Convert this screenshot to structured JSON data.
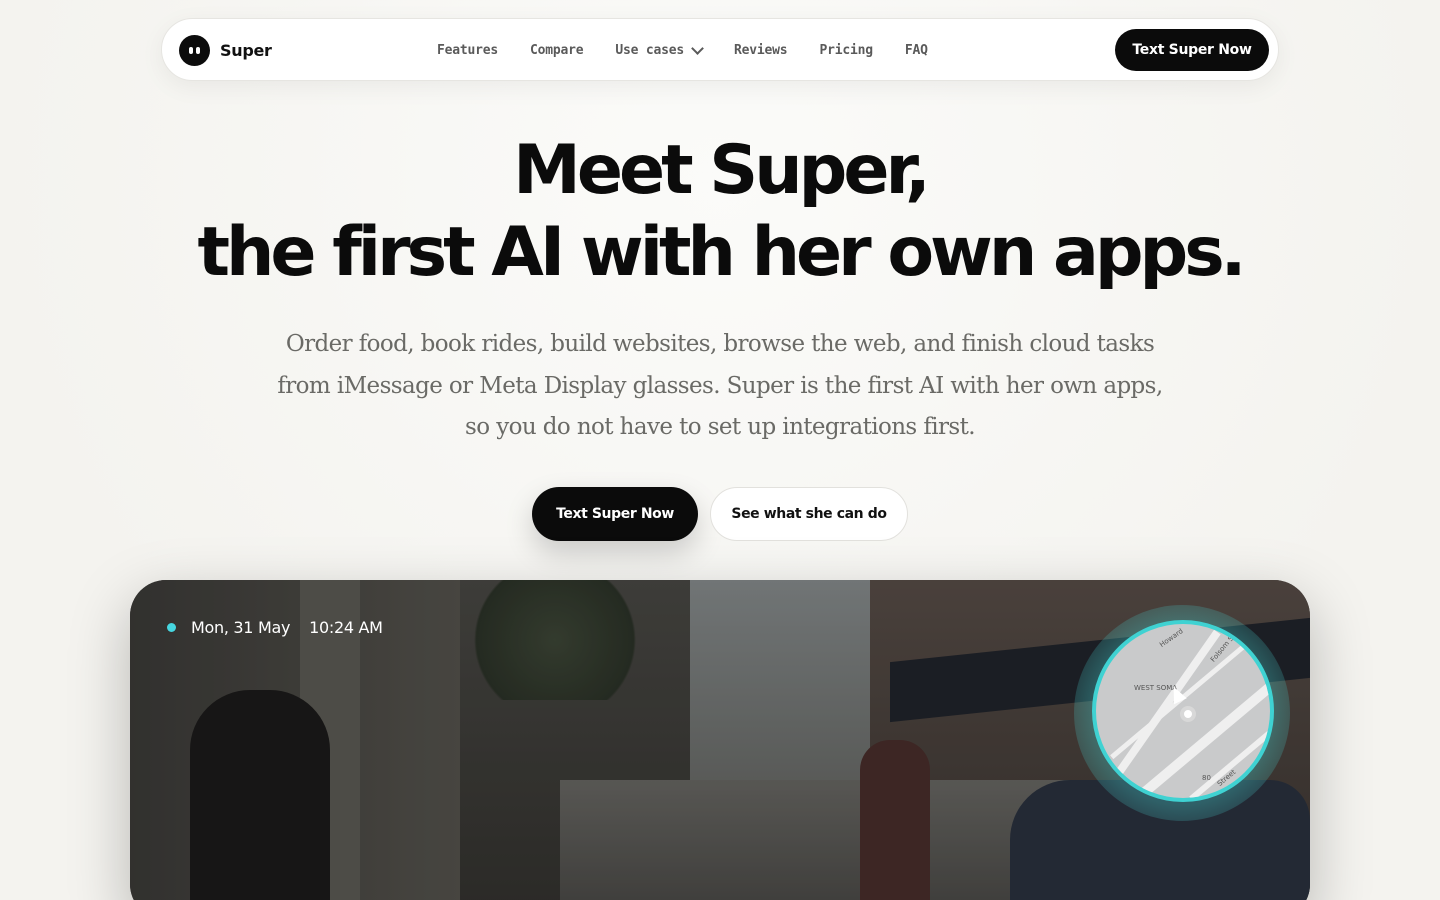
{
  "nav": {
    "brand": "Super",
    "links": [
      "Features",
      "Compare",
      "Use cases",
      "Reviews",
      "Pricing",
      "FAQ"
    ],
    "cta": "Text Super Now"
  },
  "hero": {
    "title_line1": "Meet Super,",
    "title_line2": "the first AI with her own apps.",
    "subtitle": "Order food, book rides, build websites, browse the web, and finish cloud tasks from iMessage or Meta Display glasses. Super is the first AI with her own apps, so you do not have to set up integrations first.",
    "primary_cta": "Text Super Now",
    "secondary_cta": "See what she can do"
  },
  "video": {
    "date": "Mon, 31 May",
    "time": "10:24 AM",
    "map_labels": [
      "WEST SOMA",
      "Folsom St",
      "Howard",
      "Street",
      "80"
    ]
  },
  "colors": {
    "accent": "#46d6e0",
    "dark": "#0b0b0b",
    "background": "#f6f5f2"
  }
}
